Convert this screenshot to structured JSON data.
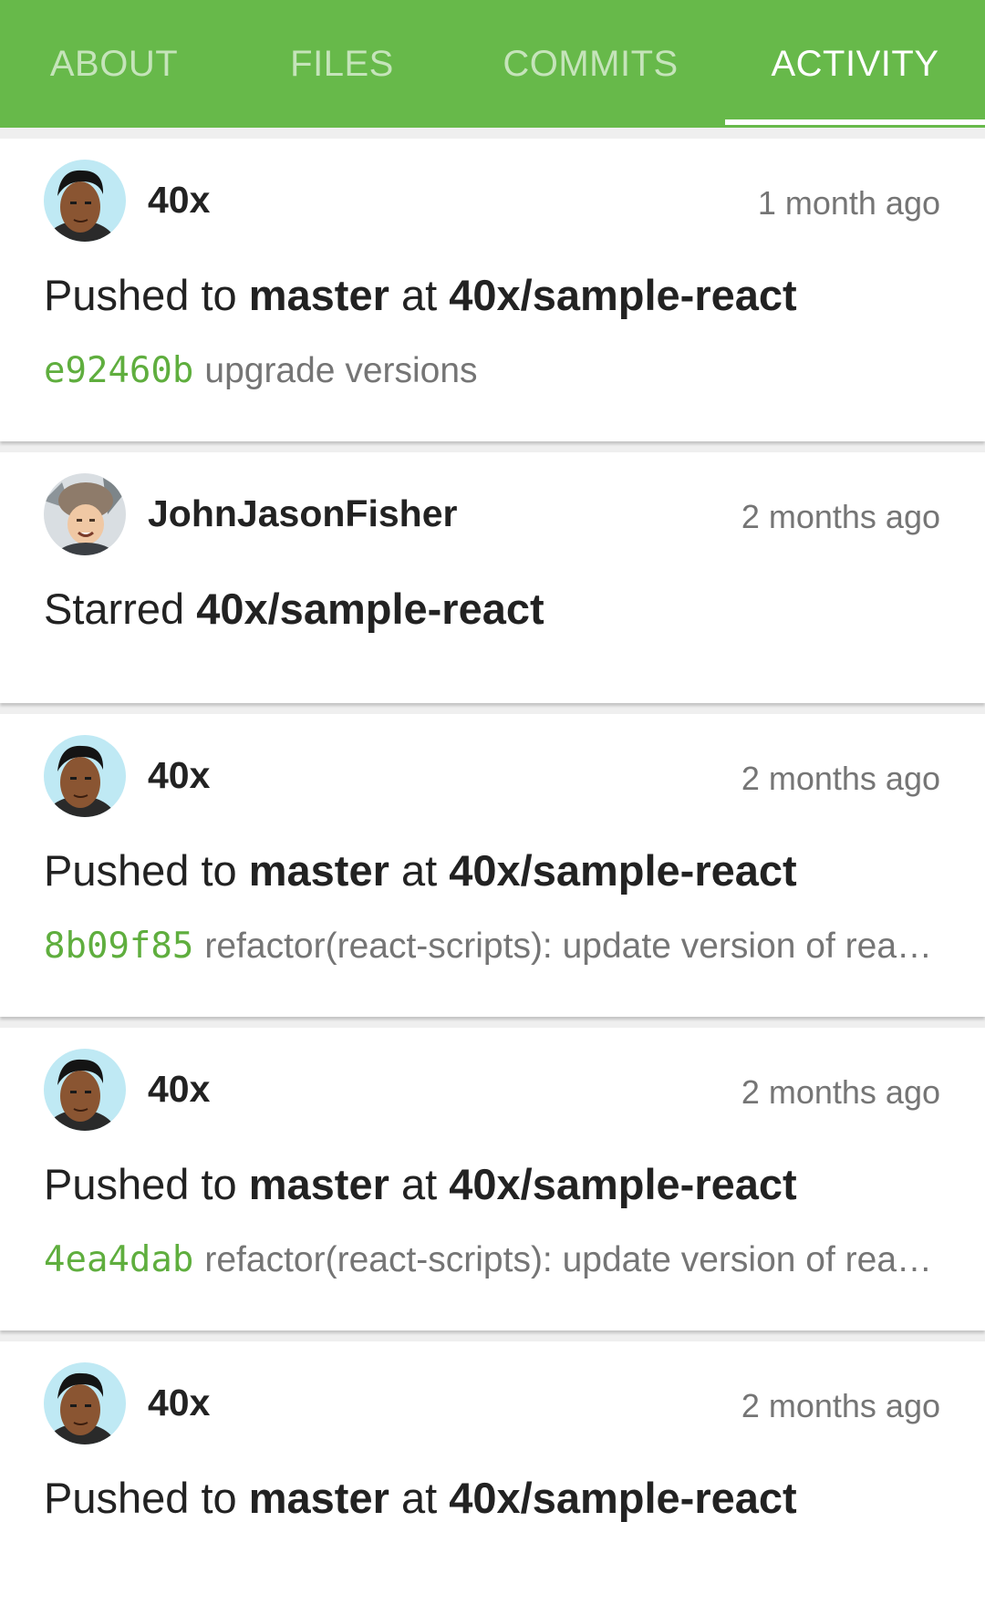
{
  "theme": {
    "accent": "#67b94a",
    "sha_color": "#5fae3e",
    "muted": "#757575"
  },
  "tabs": [
    {
      "label": "ABOUT"
    },
    {
      "label": "FILES"
    },
    {
      "label": "COMMITS"
    },
    {
      "label": "ACTIVITY",
      "selected": true
    }
  ],
  "feed": [
    {
      "user": "40x",
      "time": "1 month ago",
      "verb": "Pushed to",
      "branch": "master",
      "at": "at",
      "repo": "40x/sample-react",
      "sha": "e92460b",
      "message": "upgrade versions"
    },
    {
      "user": "JohnJasonFisher",
      "time": "2 months ago",
      "verb": "Starred",
      "repo": "40x/sample-react"
    },
    {
      "user": "40x",
      "time": "2 months ago",
      "verb": "Pushed to",
      "branch": "master",
      "at": "at",
      "repo": "40x/sample-react",
      "sha": "8b09f85",
      "message": "refactor(react-scripts): update version of react-scripts"
    },
    {
      "user": "40x",
      "time": "2 months ago",
      "verb": "Pushed to",
      "branch": "master",
      "at": "at",
      "repo": "40x/sample-react",
      "sha": "4ea4dab",
      "message": "refactor(react-scripts): update version of react-scripts"
    },
    {
      "user": "40x",
      "time": "2 months ago",
      "verb": "Pushed to",
      "branch": "master",
      "at": "at",
      "repo": "40x/sample-react"
    }
  ]
}
